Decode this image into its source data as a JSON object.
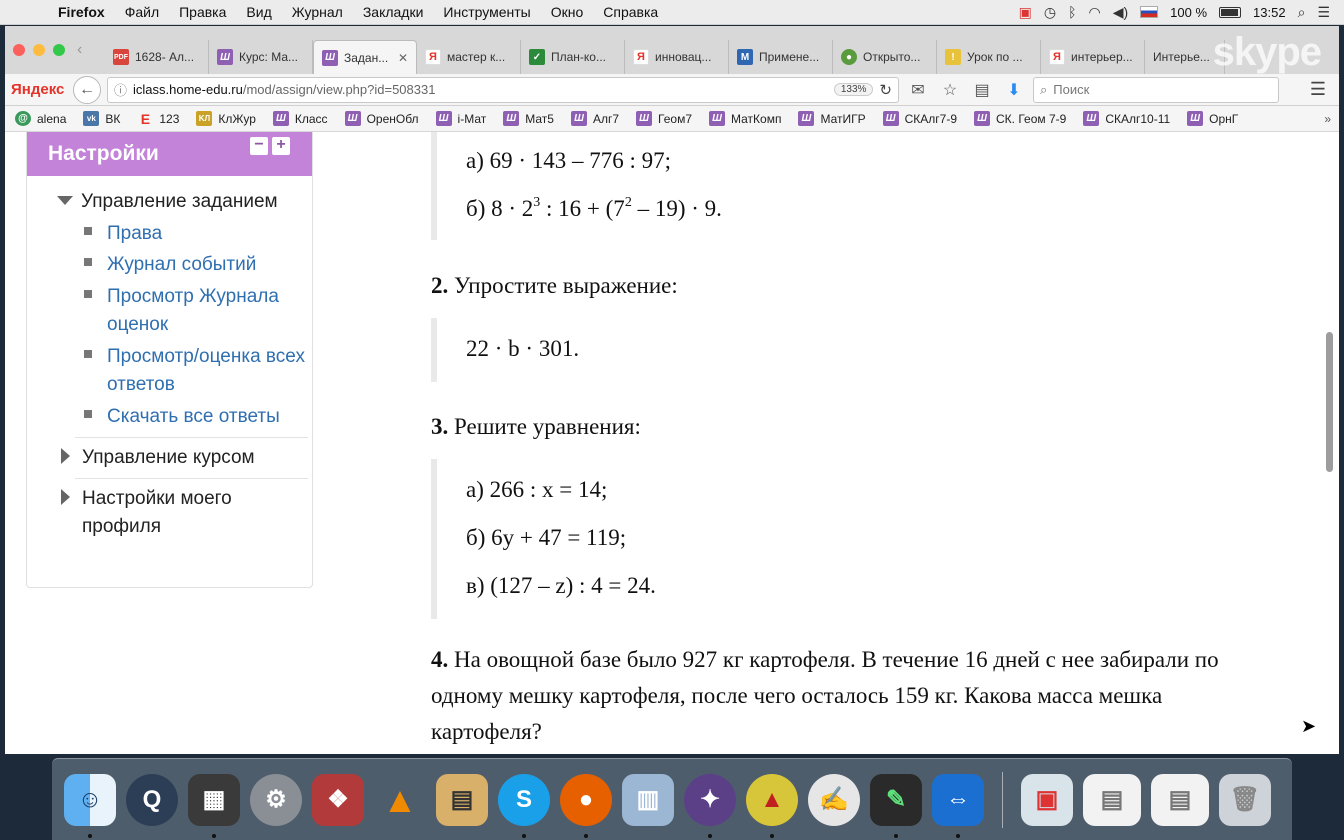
{
  "menubar": {
    "items": [
      "Firefox",
      "Файл",
      "Правка",
      "Вид",
      "Журнал",
      "Закладки",
      "Инструменты",
      "Окно",
      "Справка"
    ],
    "battery": "100 %",
    "time": "13:52"
  },
  "tabs": [
    {
      "label": "1628- Ал...",
      "icon": "pdf-icon"
    },
    {
      "label": "Курс: Ма...",
      "icon": "moodle-icon"
    },
    {
      "label": "Задан...",
      "icon": "moodle-icon",
      "active": true
    },
    {
      "label": "мастер к...",
      "icon": "yandex-icon"
    },
    {
      "label": "План-ко...",
      "icon": "check-icon"
    },
    {
      "label": "инновац...",
      "icon": "yandex-icon"
    },
    {
      "label": "Примене...",
      "icon": "m-icon"
    },
    {
      "label": "Открыто...",
      "icon": "globe-icon"
    },
    {
      "label": "Урок по ...",
      "icon": "pin-icon"
    },
    {
      "label": "интерьер...",
      "icon": "yandex-icon"
    },
    {
      "label": "Интерье...",
      "icon": "none"
    }
  ],
  "skype_label": "skype",
  "navbar": {
    "brand": "Яндекс",
    "url_host": "iclass.home-edu.ru",
    "url_path": "/mod/assign/view.php?id=508331",
    "zoom": "133%",
    "search_placeholder": "Поиск"
  },
  "bookmarks": [
    {
      "label": "alena",
      "icon": "at"
    },
    {
      "label": "ВК",
      "icon": "vk"
    },
    {
      "label": "123",
      "icon": "e"
    },
    {
      "label": "КлЖур",
      "icon": "kl"
    },
    {
      "label": "Класс",
      "icon": "w"
    },
    {
      "label": "ОренОбл",
      "icon": "w"
    },
    {
      "label": "i-Мат",
      "icon": "w"
    },
    {
      "label": "Мат5",
      "icon": "w"
    },
    {
      "label": "Алг7",
      "icon": "w"
    },
    {
      "label": "Геом7",
      "icon": "w"
    },
    {
      "label": "МатКомп",
      "icon": "w"
    },
    {
      "label": "МатИГР",
      "icon": "w"
    },
    {
      "label": "СКАлг7-9",
      "icon": "w"
    },
    {
      "label": "СК. Геом 7-9",
      "icon": "w"
    },
    {
      "label": "СКАлг10-11",
      "icon": "w"
    },
    {
      "label": "ОрнГ",
      "icon": "w"
    }
  ],
  "settings": {
    "title": "Настройки",
    "assign_admin": "Управление заданием",
    "sub": [
      "Права",
      "Журнал событий",
      "Просмотр Журнала оценок",
      "Просмотр/оценка всех ответов",
      "Скачать все ответы"
    ],
    "course_admin": "Управление курсом",
    "profile": "Настройки моего профиля"
  },
  "doc": {
    "t1a": "а) 69 · 143 – 776 : 97;",
    "t1b_pre": "б) 8 · 2",
    "t1b_exp1": "3",
    "t1b_mid": " : 16 + (7",
    "t1b_exp2": "2",
    "t1b_post": " – 19) · 9.",
    "t2_num": "2.",
    "t2_text": " Упростите выражение:",
    "t2_expr": "22 · b · 301.",
    "t3_num": "3.",
    "t3_text": " Решите уравнения:",
    "t3a": "а) 266 : x = 14;",
    "t3b": "б) 6y + 47 = 119;",
    "t3c": "в) (127 – z) : 4 = 24.",
    "t4_num": "4.",
    "t4_line1": " На овощной базе было 927 кг картофеля. В течение 16 дней с нее забирали по",
    "t4_line2": "одному мешку картофеля, после чего осталось 159 кг. Какова масса мешка",
    "t4_line3": "картофеля?"
  },
  "dock": [
    "finder-icon",
    "quicktime-icon",
    "photo-booth-icon",
    "system-preferences-icon",
    "photos-icon",
    "vlc-icon",
    "calculator-icon",
    "skype-icon",
    "firefox-icon",
    "preview-icon",
    "unknown-app-icon",
    "geogebra-icon",
    "script-icon",
    "art-app-icon",
    "teamviewer-icon",
    "document-icon",
    "screenshot-icon",
    "screenshot-icon",
    "trash-icon"
  ]
}
